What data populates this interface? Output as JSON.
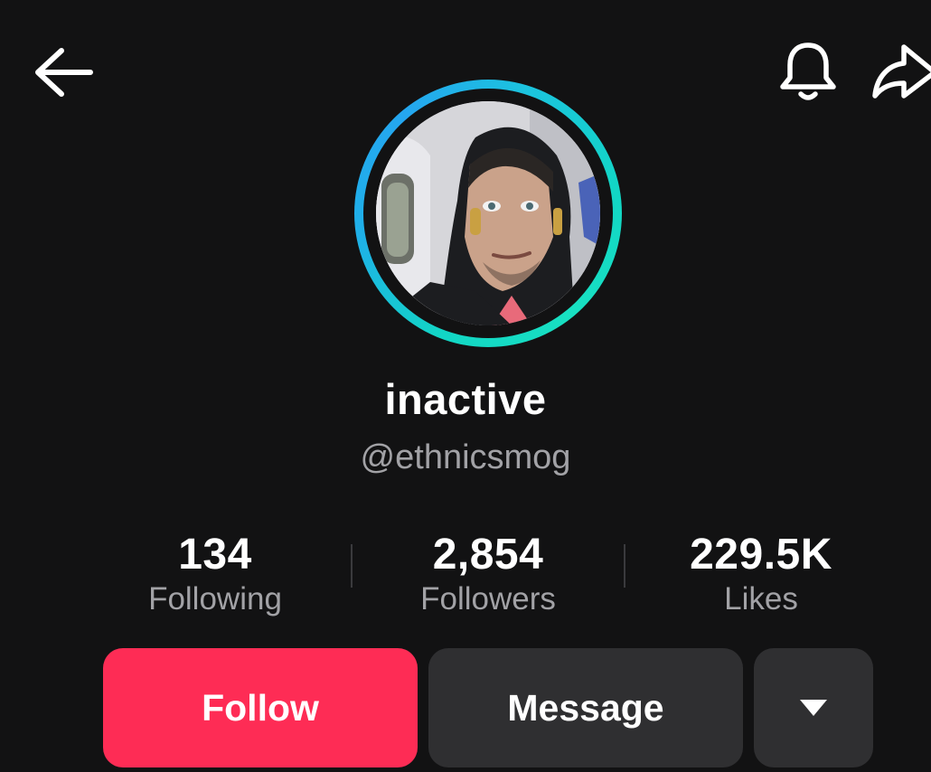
{
  "profile": {
    "display_name": "inactive",
    "handle": "@ethnicsmog"
  },
  "stats": [
    {
      "value": "134",
      "label": "Following"
    },
    {
      "value": "2,854",
      "label": "Followers"
    },
    {
      "value": "229.5K",
      "label": "Likes"
    }
  ],
  "actions": {
    "follow_label": "Follow",
    "message_label": "Message"
  },
  "icons": {
    "back": "arrow-left-icon",
    "notifications": "bell-icon",
    "share": "share-arrow-icon",
    "more": "caret-down-icon"
  },
  "colors": {
    "background": "#121213",
    "follow": "#fe2c55",
    "secondary_button": "#2f2f31",
    "muted_text": "#a2a2a6",
    "ring_cyan": "#1bc4dd",
    "ring_blue": "#25a6f0"
  }
}
